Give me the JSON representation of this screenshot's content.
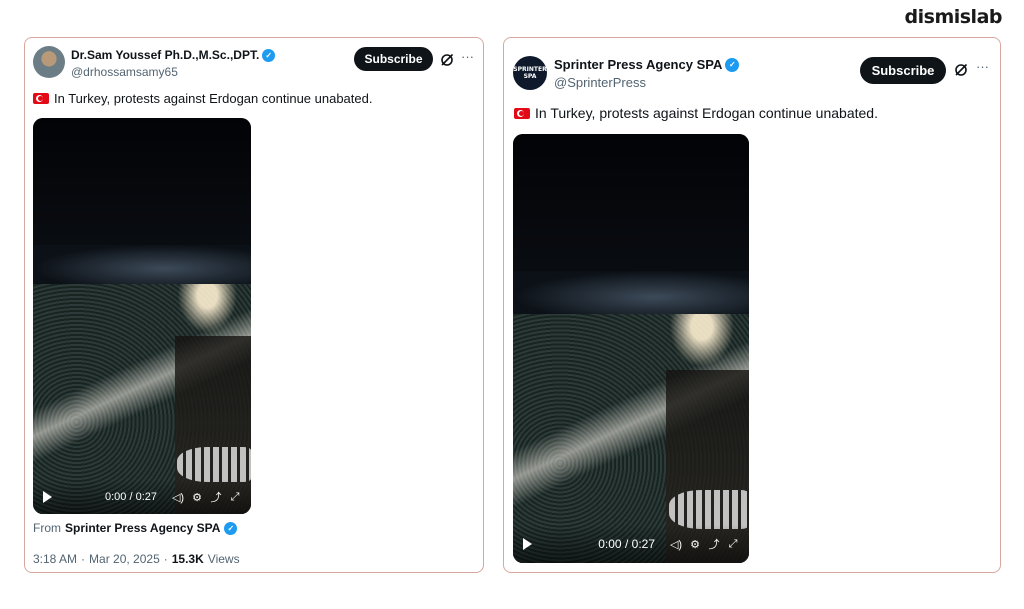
{
  "brand": "dismislab",
  "left_post": {
    "display_name": "Dr.Sam Youssef Ph.D.,M.Sc.,DPT.",
    "handle": "@drhossamsamy65",
    "subscribe_label": "Subscribe",
    "more_label": "···",
    "text": "In Turkey, protests against Erdogan continue unabated.",
    "video": {
      "current_time": "0:00",
      "separator": "/",
      "duration": "0:27"
    },
    "from_label": "From",
    "from_source": "Sprinter Press Agency SPA",
    "time": "3:18 AM",
    "dot": "·",
    "date": "Mar 20, 2025",
    "views_count": "15.3K",
    "views_label": "Views"
  },
  "right_post": {
    "display_name": "Sprinter Press Agency SPA",
    "handle": "@SprinterPress",
    "subscribe_label": "Subscribe",
    "more_label": "···",
    "text": "In Turkey, protests against Erdogan continue unabated.",
    "video": {
      "current_time": "0:00",
      "separator": "/",
      "duration": "0:27"
    },
    "avatar_logo_top": "SPRINTER",
    "avatar_logo_bottom": "SPA"
  },
  "colors": {
    "verified": "#1d9bf0",
    "card_border": "#d9a79f",
    "button_bg": "#0f1419"
  },
  "icons": [
    "verified-badge-icon",
    "grok-icon",
    "more-icon",
    "turkey-flag-icon",
    "play-icon",
    "volume-icon",
    "settings-icon",
    "pip-icon",
    "fullscreen-icon"
  ]
}
